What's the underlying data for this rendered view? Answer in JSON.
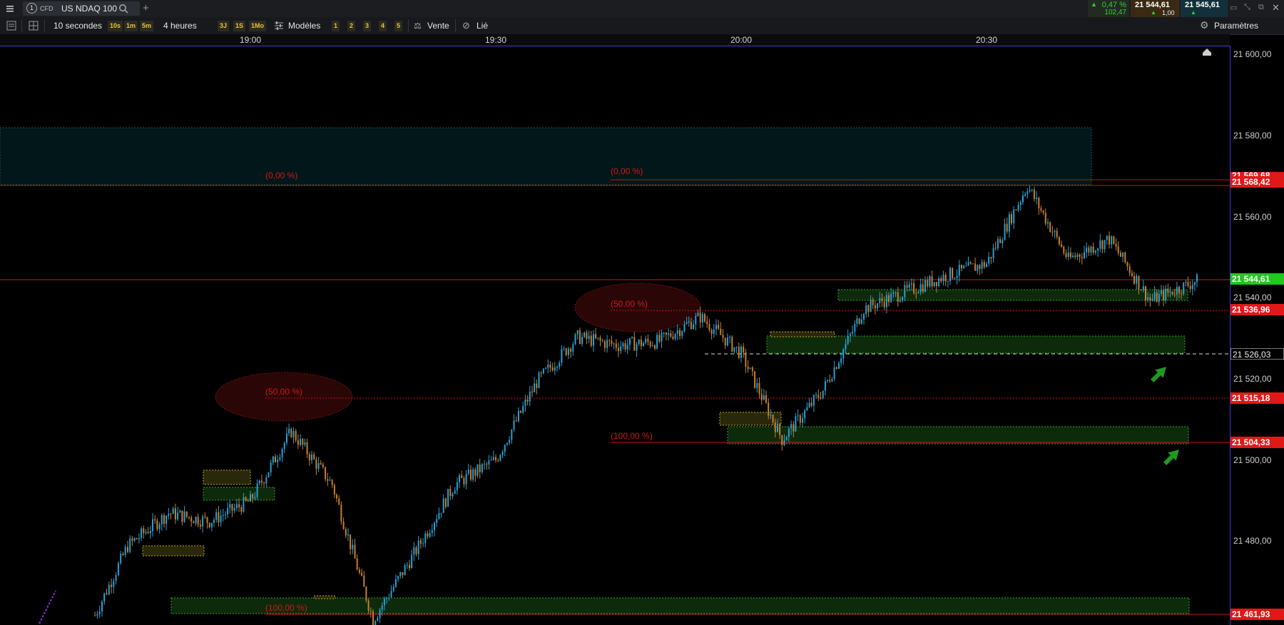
{
  "toolbar_top": {
    "menu_icon": "hamburger-icon",
    "tab_number": "1",
    "cfd_badge": "CFD",
    "instrument": "US NDAQ 100",
    "add_tab": "+",
    "change_pct": "0,47 %",
    "change_abs": "102,47",
    "bid": "21 544,61",
    "spread": "1,00",
    "ask": "21 545,61"
  },
  "toolbar_bottom": {
    "interval": "10 secondes",
    "intervals": [
      "10s",
      "1m",
      "5m"
    ],
    "range": "4 heures",
    "ranges": [
      "3J",
      "1S",
      "1Mo"
    ],
    "models": "Modèles",
    "layouts": [
      "1",
      "2",
      "3",
      "4",
      "5"
    ],
    "sell": "Vente",
    "linked": "Lié",
    "settings": "Paramètres"
  },
  "time_axis": [
    "19:00",
    "19:30",
    "20:00",
    "20:30"
  ],
  "price_axis": [
    "21 600,00",
    "21 580,00",
    "21 560,00",
    "21 540,00",
    "21 520,00",
    "21 500,00",
    "21 480,00"
  ],
  "price_tags": {
    "top_hidden": "21 569,68",
    "high": "21 568,42",
    "current": "21 544,61",
    "level_a": "21 536,96",
    "dashed": "21 526,03",
    "level_b": "21 515,18",
    "level_c": "21 504,33",
    "low": "21 461,93"
  },
  "fib_labels": {
    "left_0": "(0,00 %)",
    "left_50": "(50,00 %)",
    "left_100": "(100,00 %)",
    "right_0": "(0,00 %)",
    "right_50": "(50,00 %)",
    "right_100": "(100,00 %)"
  },
  "colors": {
    "accent_green": "#1ec81e",
    "accent_red": "#e01818",
    "candle_up": "#2a9fd6",
    "candle_down": "#c87f2a",
    "zone_green": "#1a5a14",
    "zone_yellow": "#6a6010"
  },
  "chart_data": {
    "type": "line",
    "title": "US NDAQ 100",
    "x": [
      "18:41",
      "18:45",
      "18:50",
      "18:55",
      "19:00",
      "19:05",
      "19:10",
      "19:15",
      "19:20",
      "19:25",
      "19:30",
      "19:35",
      "19:40",
      "19:45",
      "19:50",
      "19:55",
      "20:00",
      "20:05",
      "20:10",
      "20:15",
      "20:20",
      "20:25",
      "20:30",
      "20:35",
      "20:40",
      "20:45",
      "20:50",
      "20:56"
    ],
    "series": [
      {
        "values": [
          21463,
          21480,
          21488,
          21486,
          21491,
          21508,
          21495,
          21462,
          21478,
          21495,
          21501,
          21520,
          21531,
          21529,
          21530,
          21536,
          21527,
          21506,
          21518,
          21538,
          21542,
          21546,
          21549,
          21568,
          21550,
          21555,
          21540,
          21545
        ]
      }
    ],
    "ylim": [
      21460,
      21602
    ],
    "grid": false
  }
}
